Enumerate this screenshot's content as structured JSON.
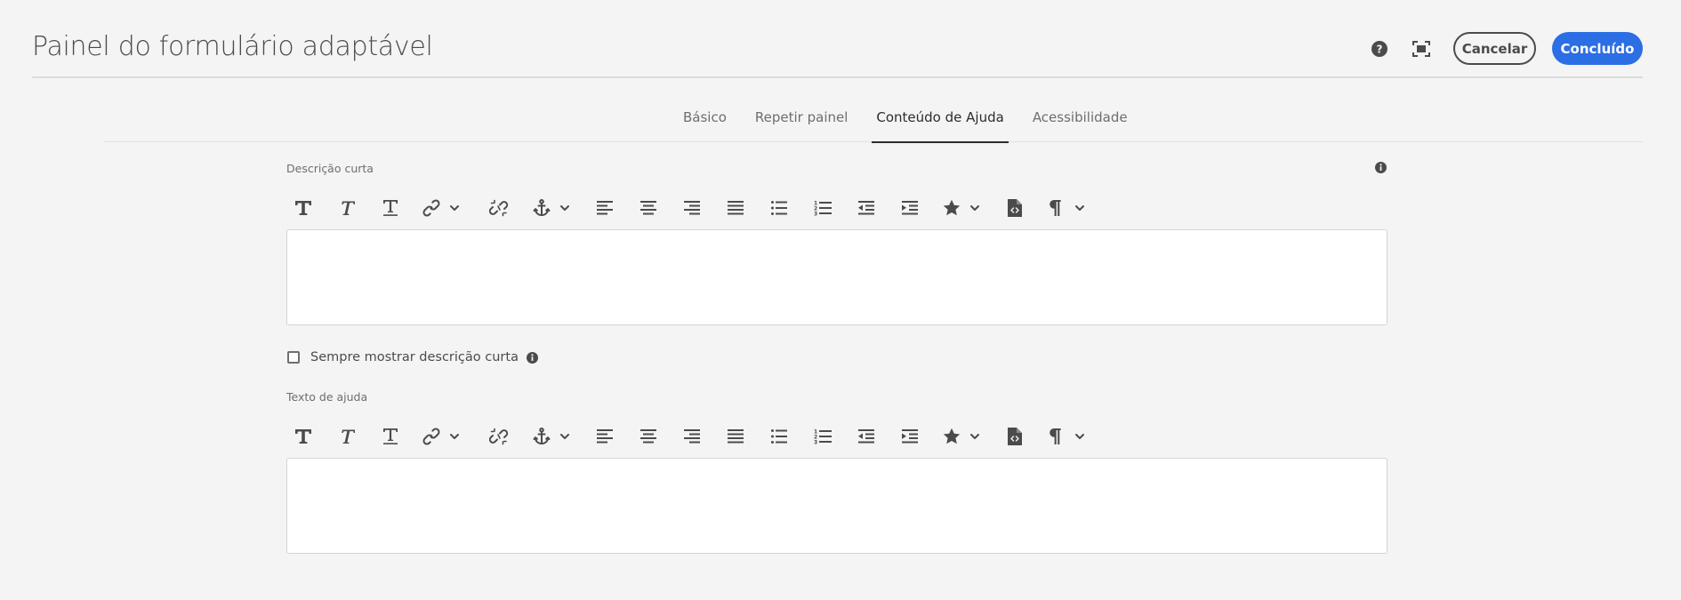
{
  "header": {
    "title": "Painel do formulário adaptável",
    "help_icon": "help-icon",
    "fullscreen_icon": "fullscreen-icon",
    "cancel_label": "Cancelar",
    "done_label": "Concluído",
    "done_color": "#2c6ee3"
  },
  "tabs": [
    {
      "label": "Básico",
      "active": false
    },
    {
      "label": "Repetir painel",
      "active": false
    },
    {
      "label": "Conteúdo de Ajuda",
      "active": true
    },
    {
      "label": "Acessibilidade",
      "active": false
    }
  ],
  "short_description": {
    "label": "Descrição curta",
    "value": ""
  },
  "always_show": {
    "label": "Sempre mostrar descrição curta",
    "checked": false
  },
  "help_text": {
    "label": "Texto de ajuda",
    "value": ""
  },
  "toolbar_icons": [
    "bold-icon",
    "italic-icon",
    "underline-icon",
    "link-icon",
    "unlink-icon",
    "anchor-icon",
    "align-left-icon",
    "align-center-icon",
    "align-right-icon",
    "justify-icon",
    "bullet-list-icon",
    "numbered-list-icon",
    "outdent-icon",
    "indent-icon",
    "special-character-icon",
    "source-edit-icon",
    "paragraph-format-icon"
  ]
}
